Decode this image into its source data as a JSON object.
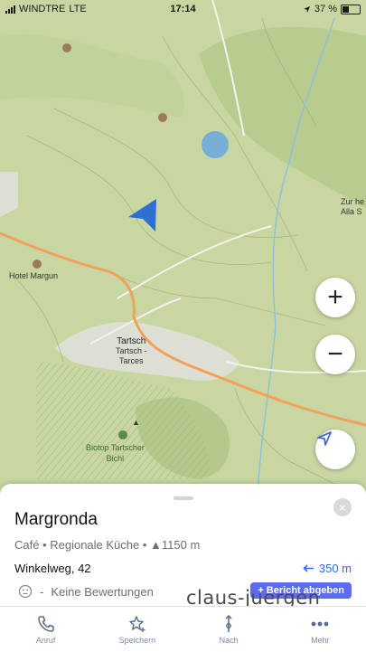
{
  "status": {
    "carrier": "WINDTRE",
    "network": "LTE",
    "time": "17:14",
    "battery": "37 %"
  },
  "map": {
    "labels": {
      "hotel": "Hotel Margun",
      "town_line1": "Tartsch",
      "town_line2": "Tartsch -",
      "town_line3": "Tarces",
      "biotop_line1": "Biotop Tartscher",
      "biotop_line2": "Bichl",
      "edge_line1": "Zur he",
      "edge_line2": "Alla S"
    },
    "zoom_in": "+",
    "zoom_out": "−"
  },
  "place": {
    "name": "Margronda",
    "category": "Café • Regionale Küche • ▲1150 m",
    "address": "Winkelweg, 42",
    "distance": "350 m",
    "rating_dash": "-",
    "rating_text": "Keine Bewertungen",
    "rate_button": "+ Bericht abgeben",
    "close": "×"
  },
  "watermark": "claus-juergen",
  "tabs": [
    {
      "label": "Anruf",
      "icon": "phone-icon"
    },
    {
      "label": "Speichern",
      "icon": "star-plus-icon"
    },
    {
      "label": "Nach",
      "icon": "route-icon"
    },
    {
      "label": "Mehr",
      "icon": "more-dots-icon"
    }
  ],
  "colors": {
    "map_bg": "#c9d7a4",
    "road": "#f2a15c",
    "accent": "#2f6df6",
    "button": "#5b6cf0"
  }
}
